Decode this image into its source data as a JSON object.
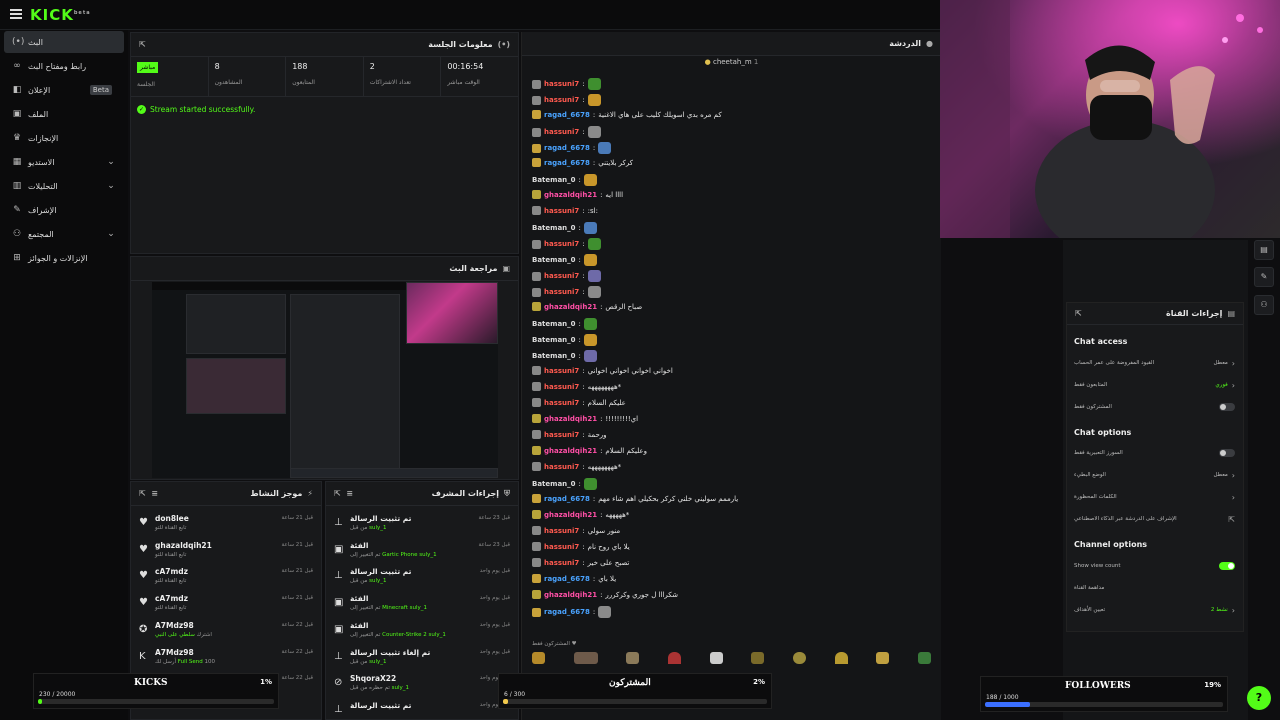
{
  "brand": {
    "logo": "KICK",
    "logo_sup": "beta",
    "accent": "#53fc18"
  },
  "sidebar": {
    "items": [
      {
        "label": "البث",
        "icon": "broadcast-icon",
        "active": true
      },
      {
        "label": "رابط ومفتاح البث",
        "icon": "link-icon"
      },
      {
        "label": "الإعلان",
        "icon": "ad-icon",
        "badge": "Beta"
      },
      {
        "label": "الملف",
        "icon": "file-icon"
      },
      {
        "label": "الإنجازات",
        "icon": "trophy-icon"
      },
      {
        "label": "الاستديو",
        "icon": "studio-icon",
        "expand": true
      },
      {
        "label": "التحليلات",
        "icon": "analytics-icon",
        "expand": true
      },
      {
        "label": "الإشراف",
        "icon": "moderation-icon"
      },
      {
        "label": "المجتمع",
        "icon": "community-icon",
        "expand": true
      },
      {
        "label": "الإنزالات و الجوائز",
        "icon": "drops-icon"
      }
    ]
  },
  "session": {
    "title": "معلومات الجلسة",
    "live": "مباشر",
    "live_label": "الجلسة",
    "stats": [
      {
        "value": "8",
        "label": "المشاهدون"
      },
      {
        "value": "188",
        "label": "المتابعون"
      },
      {
        "value": "2",
        "label": "تعداد الاشتراكات"
      },
      {
        "value": "00:16:54",
        "label": "الوقت مباشر"
      }
    ],
    "message": "Stream started successfully."
  },
  "preview": {
    "title": "مراجعة البث"
  },
  "activity": {
    "title": "موجز النشاط",
    "items": [
      {
        "name": "don8lee",
        "sub": "تابع القناة للتو",
        "time": "قبل 21 ساعة",
        "icon": "heart-icon"
      },
      {
        "name": "ghazaldqih21",
        "sub": "تابع القناة للتو",
        "time": "قبل 21 ساعة",
        "icon": "heart-icon"
      },
      {
        "name": "cA7mdz",
        "sub": "تابع القناة للتو",
        "time": "قبل 21 ساعة",
        "icon": "heart-icon"
      },
      {
        "name": "cA7mdz",
        "sub": "تابع القناة للتو",
        "time": "قبل 21 ساعة",
        "icon": "heart-icon"
      },
      {
        "name": "A7Mdz98",
        "sub": "اشترك",
        "sub_green": "سلطي على النبي",
        "time": "قبل 22 ساعة",
        "icon": "sub-icon"
      },
      {
        "name": "A7Mdz98",
        "sub": "أرسل لك",
        "sub_green": "Full Send",
        "extra": "100",
        "time": "قبل 22 ساعة",
        "icon": "kick-icon"
      },
      {
        "name": "",
        "sub": "",
        "time": "قبل 22 ساعة",
        "icon": "heart-icon"
      }
    ]
  },
  "modactions": {
    "title": "إجراءات المشرف",
    "items": [
      {
        "name": "تم تثبيت الرسالة",
        "sub": "من قبل",
        "who": "suly_1",
        "time": "قبل 23 ساعة",
        "icon": "pin-icon"
      },
      {
        "name": "الفئة",
        "sub": "تم التغيير إلى",
        "what": "Gartic Phone",
        "who": "suly_1",
        "time": "قبل 23 ساعة",
        "icon": "category-icon"
      },
      {
        "name": "تم تثبيت الرسالة",
        "sub": "من قبل",
        "who": "suly_1",
        "time": "قبل يوم واحد",
        "icon": "pin-icon"
      },
      {
        "name": "الفئة",
        "sub": "تم التغيير إلى",
        "what": "Minecraft",
        "who": "suly_1",
        "time": "قبل يوم واحد",
        "icon": "category-icon"
      },
      {
        "name": "الفئة",
        "sub": "تم التغيير إلى",
        "what": "Counter-Strike 2",
        "who": "suly_1",
        "time": "قبل يوم واحد",
        "icon": "category-icon"
      },
      {
        "name": "تم إلغاء تثبيت الرسالة",
        "sub": "من قبل",
        "who": "suly_1",
        "time": "قبل يوم واحد",
        "icon": "unpin-icon"
      },
      {
        "name": "ShqoraX22",
        "sub": "تم حظره من قبل",
        "who": "suly_1",
        "time": "قبل يوم واحد",
        "icon": "ban-icon"
      },
      {
        "name": "تم تثبيت الرسالة",
        "sub": "",
        "who": "",
        "time": "قبل يوم واحد",
        "icon": "pin-icon"
      }
    ]
  },
  "chat": {
    "title": "الدردشة",
    "pinned_user": "cheetah_m",
    "messages": [
      {
        "user": "hassuni7",
        "color": "#ff5a4f",
        "badge": "#888",
        "text": ""
      },
      {
        "user": "hassuni7",
        "color": "#ff5a4f",
        "badge": "#888",
        "text": ""
      },
      {
        "user": "ragad_6678",
        "color": "#4aa3ff",
        "badge": "#c8a23a",
        "text": "كم مره بدي اسويلك كليب على هاي الاغنية"
      },
      {
        "user": "hassuni7",
        "color": "#ff5a4f",
        "badge": "#888",
        "text": ""
      },
      {
        "user": "ragad_6678",
        "color": "#4aa3ff",
        "badge": "#c8a23a",
        "text": ""
      },
      {
        "user": "ragad_6678",
        "color": "#4aa3ff",
        "badge": "#c8a23a",
        "text": "كركر بلايتني"
      },
      {
        "user": "Bateman_0",
        "color": "#dddddd",
        "badge": "",
        "text": ""
      },
      {
        "user": "ghazaldqih21",
        "color": "#ff4fa6",
        "badge": "#b8a43a",
        "text": "llll ايه"
      },
      {
        "user": "hassuni7",
        "color": "#ff5a4f",
        "badge": "#888",
        "text": ":sl:"
      },
      {
        "user": "Bateman_0",
        "color": "#dddddd",
        "badge": "",
        "text": ""
      },
      {
        "user": "hassuni7",
        "color": "#ff5a4f",
        "badge": "#888",
        "text": ""
      },
      {
        "user": "Bateman_0",
        "color": "#dddddd",
        "badge": "",
        "text": ""
      },
      {
        "user": "hassuni7",
        "color": "#ff5a4f",
        "badge": "#888",
        "text": ""
      },
      {
        "user": "hassuni7",
        "color": "#ff5a4f",
        "badge": "#888",
        "text": ""
      },
      {
        "user": "ghazaldqih21",
        "color": "#ff4fa6",
        "badge": "#b8a43a",
        "text": "صباح الرقص"
      },
      {
        "user": "Bateman_0",
        "color": "#dddddd",
        "badge": "",
        "text": ""
      },
      {
        "user": "Bateman_0",
        "color": "#dddddd",
        "badge": "",
        "text": ""
      },
      {
        "user": "Bateman_0",
        "color": "#dddddd",
        "badge": "",
        "text": ""
      },
      {
        "user": "hassuni7",
        "color": "#ff5a4f",
        "badge": "#888",
        "text": "اخواني اخواني اخواني اخواني"
      },
      {
        "user": "hassuni7",
        "color": "#ff5a4f",
        "badge": "#888",
        "text": "*ههههههههه"
      },
      {
        "user": "hassuni7",
        "color": "#ff5a4f",
        "badge": "#888",
        "text": "عليكم السلام"
      },
      {
        "user": "ghazaldqih21",
        "color": "#ff4fa6",
        "badge": "#b8a43a",
        "text": "اي!!!!!!!!!"
      },
      {
        "user": "hassuni7",
        "color": "#ff5a4f",
        "badge": "#888",
        "text": "ورحمة"
      },
      {
        "user": "ghazaldqih21",
        "color": "#ff4fa6",
        "badge": "#b8a43a",
        "text": "وعليكم السلام"
      },
      {
        "user": "hassuni7",
        "color": "#ff5a4f",
        "badge": "#888",
        "text": "*ههههههههه"
      },
      {
        "user": "Bateman_0",
        "color": "#dddddd",
        "badge": "",
        "text": ""
      },
      {
        "user": "ragad_6678",
        "color": "#4aa3ff",
        "badge": "#c8a23a",
        "text": "يارممم سوليني خلني كركر بحكيلي اهم شاء مهم"
      },
      {
        "user": "ghazaldqih21",
        "color": "#ff4fa6",
        "badge": "#b8a43a",
        "text": "*هههههه"
      },
      {
        "user": "hassuni7",
        "color": "#ff5a4f",
        "badge": "#888",
        "text": "منور سولي"
      },
      {
        "user": "hassuni7",
        "color": "#ff5a4f",
        "badge": "#888",
        "text": "يلا باي روح نام"
      },
      {
        "user": "hassuni7",
        "color": "#ff5a4f",
        "badge": "#888",
        "text": "تصبح على خير"
      },
      {
        "user": "ragad_6678",
        "color": "#4aa3ff",
        "badge": "#c8a23a",
        "text": "يلا باي"
      },
      {
        "user": "ghazaldqih21",
        "color": "#ff4fa6",
        "badge": "#b8a43a",
        "text": "شكرااا ل جوري وكركررر"
      },
      {
        "user": "ragad_6678",
        "color": "#4aa3ff",
        "badge": "#c8a23a",
        "text": ""
      }
    ],
    "subscribers_label": "المشتركون فقط"
  },
  "channel_settings": {
    "title": "إجراءات القناة",
    "chat_access": "Chat access",
    "access_rows": [
      {
        "label": "القيود المفروضة على عمر الحساب",
        "value": "معطل",
        "control": "chevron"
      },
      {
        "label": "المتابعون فقط",
        "value": "فوري",
        "control": "chevron"
      },
      {
        "label": "المشتركون فقط",
        "value": "",
        "control": "toggle-off"
      }
    ],
    "chat_options": "Chat options",
    "option_rows": [
      {
        "label": "السورز التعبيرية فقط",
        "value": "",
        "control": "toggle-off"
      },
      {
        "label": "الوضع البطيء",
        "value": "معطل",
        "control": "chevron"
      },
      {
        "label": "الكلمات المحظورة",
        "value": "",
        "control": "chevron"
      },
      {
        "label": "الإشراف على الدردشة عبر الذكاء الاصطناعي",
        "value": "",
        "control": "external"
      }
    ],
    "channel_options": "Channel options",
    "channel_rows": [
      {
        "label": "Show view count",
        "value": "",
        "control": "toggle-on"
      },
      {
        "label": "مداهمة القناة",
        "value": "",
        "control": "none"
      },
      {
        "label": "تعيين الأهداف",
        "value": "نشط 2",
        "control": "chevron"
      }
    ]
  },
  "goals": {
    "kicks": {
      "title": "KICKS",
      "percent": "1%",
      "count": "230 / 20000",
      "fill": 0.0115,
      "color": "#53fc18"
    },
    "subs": {
      "title": "المشتركون",
      "percent": "2%",
      "count": "6 / 300",
      "fill": 0.02,
      "color": "#f2c94c"
    },
    "followers": {
      "title": "FOLLOWERS",
      "percent": "19%",
      "count": "188 / 1000",
      "fill": 0.188,
      "color": "#3b6fff"
    }
  }
}
